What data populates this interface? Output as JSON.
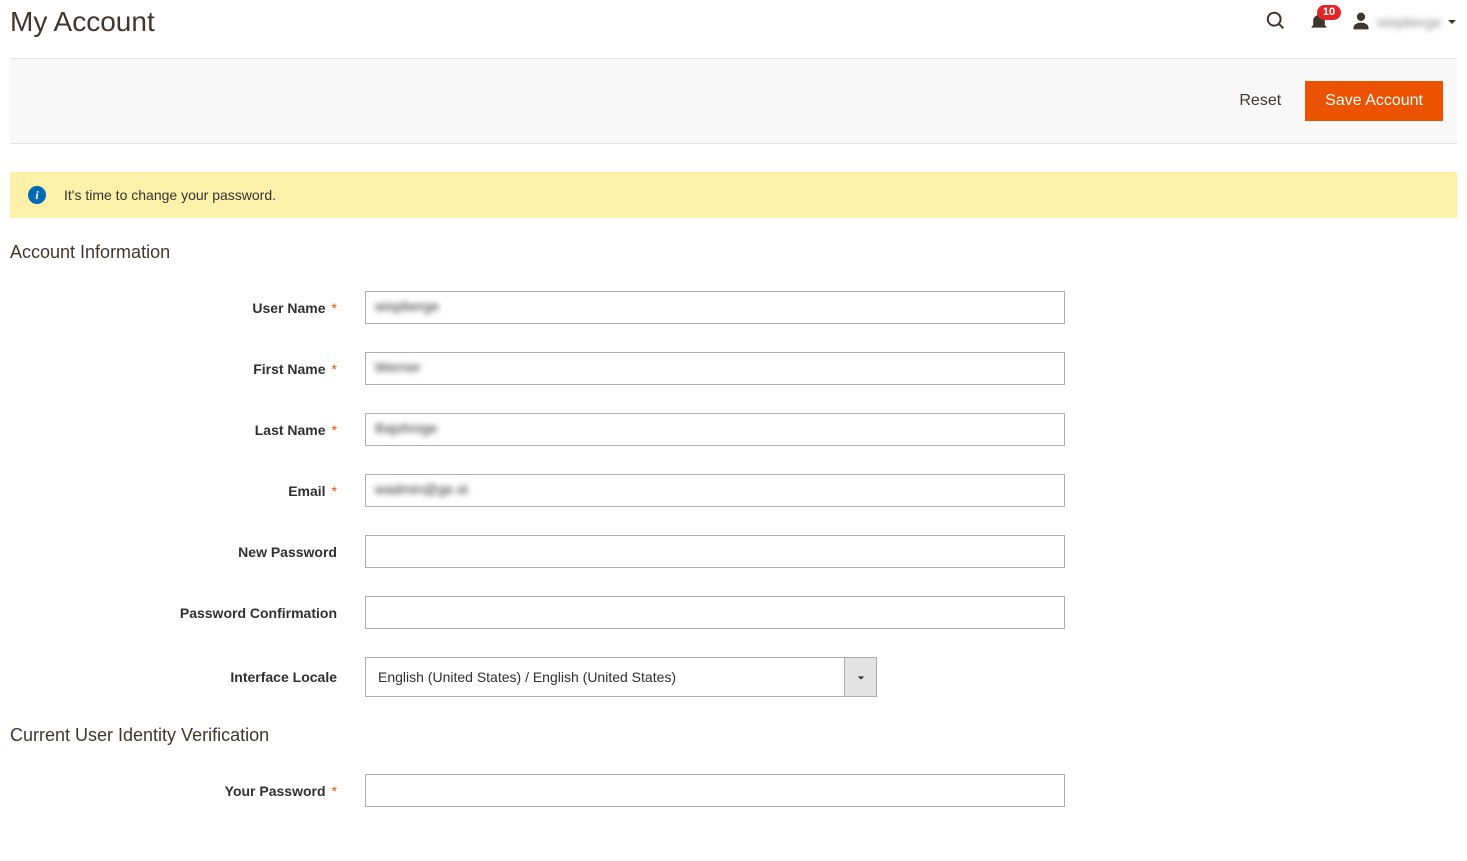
{
  "header": {
    "title": "My Account",
    "notification_count": "10",
    "user_display_name": "wispberge"
  },
  "actions": {
    "reset_label": "Reset",
    "save_label": "Save Account"
  },
  "notice": {
    "text": "It's time to change your password."
  },
  "sections": {
    "account_info_title": "Account Information",
    "identity_title": "Current User Identity Verification"
  },
  "fields": {
    "username": {
      "label": "User Name",
      "value": "wispberge"
    },
    "firstname": {
      "label": "First Name",
      "value": "Werner"
    },
    "lastname": {
      "label": "Last Name",
      "value": "Bajohnige"
    },
    "email": {
      "label": "Email",
      "value": "wadmin@ge.st"
    },
    "new_password": {
      "label": "New Password",
      "value": ""
    },
    "password_confirm": {
      "label": "Password Confirmation",
      "value": ""
    },
    "locale": {
      "label": "Interface Locale",
      "value": "English (United States) / English (United States)"
    },
    "your_password": {
      "label": "Your Password",
      "value": ""
    }
  }
}
